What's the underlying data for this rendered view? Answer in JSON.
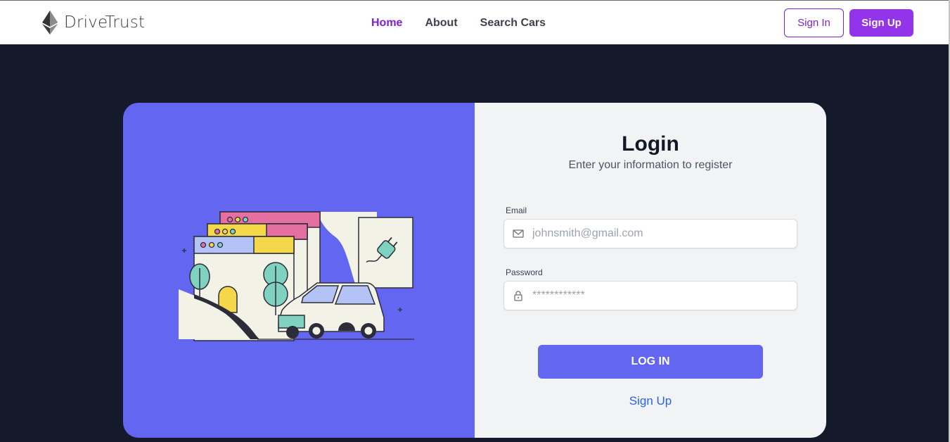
{
  "brand": {
    "name": "DriveTrust",
    "logo_icon": "ethereum-icon"
  },
  "nav": {
    "links": [
      {
        "label": "Home",
        "active": true
      },
      {
        "label": "About",
        "active": false
      },
      {
        "label": "Search Cars",
        "active": false
      }
    ],
    "sign_in_label": "Sign In",
    "sign_up_label": "Sign Up"
  },
  "login": {
    "title": "Login",
    "subtitle": "Enter your information to register",
    "email_label": "Email",
    "email_placeholder": "johnsmith@gmail.com",
    "email_icon": "mail-icon",
    "password_label": "Password",
    "password_placeholder": "************",
    "password_icon": "lock-icon",
    "submit_label": "LOG IN",
    "signup_link": "Sign Up"
  },
  "colors": {
    "accent_purple": "#9333ea",
    "nav_active": "#7e22ce",
    "panel_indigo": "#6366f1",
    "page_bg": "#141a29",
    "link_blue": "#2563eb"
  }
}
